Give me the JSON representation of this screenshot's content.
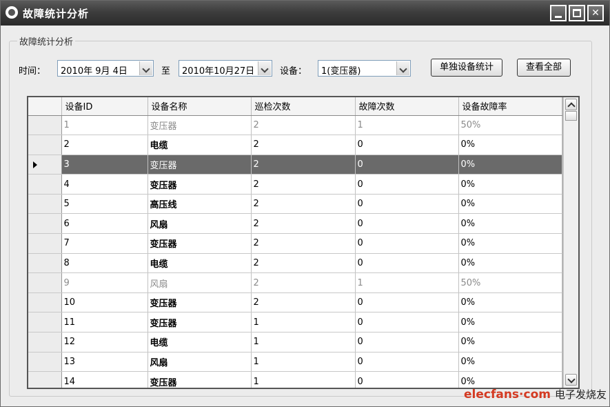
{
  "window": {
    "title": "故障统计分析"
  },
  "group": {
    "legend": "故障统计分析"
  },
  "filters": {
    "time_label": "时间：",
    "start_date": "2010年 9月 4日",
    "to_label": "至",
    "end_date": "2010年10月27日",
    "device_label": "设备：",
    "device_value": "1(变压器)",
    "single_button": "单独设备统计",
    "view_all_button": "查看全部"
  },
  "table": {
    "headers": [
      "设备ID",
      "设备名称",
      "巡检次数",
      "故障次数",
      "设备故障率"
    ],
    "rows": [
      [
        "1",
        "变压器",
        "2",
        "1",
        "50%"
      ],
      [
        "2",
        "电缆",
        "2",
        "0",
        "0%"
      ],
      [
        "3",
        "变压器",
        "2",
        "0",
        "0%"
      ],
      [
        "4",
        "变压器",
        "2",
        "0",
        "0%"
      ],
      [
        "5",
        "高压线",
        "2",
        "0",
        "0%"
      ],
      [
        "6",
        "风扇",
        "2",
        "0",
        "0%"
      ],
      [
        "7",
        "变压器",
        "2",
        "0",
        "0%"
      ],
      [
        "8",
        "电缆",
        "2",
        "0",
        "0%"
      ],
      [
        "9",
        "风扇",
        "2",
        "1",
        "50%"
      ],
      [
        "10",
        "变压器",
        "2",
        "0",
        "0%"
      ],
      [
        "11",
        "变压器",
        "1",
        "0",
        "0%"
      ],
      [
        "12",
        "电缆",
        "1",
        "0",
        "0%"
      ],
      [
        "13",
        "风扇",
        "1",
        "0",
        "0%"
      ],
      [
        "14",
        "变压器",
        "1",
        "0",
        "0%"
      ]
    ],
    "selected_row": 2,
    "dimmed_rows": [
      0,
      8
    ]
  },
  "watermark": {
    "brand": "elecfans·com",
    "cn": "电子发烧友"
  }
}
